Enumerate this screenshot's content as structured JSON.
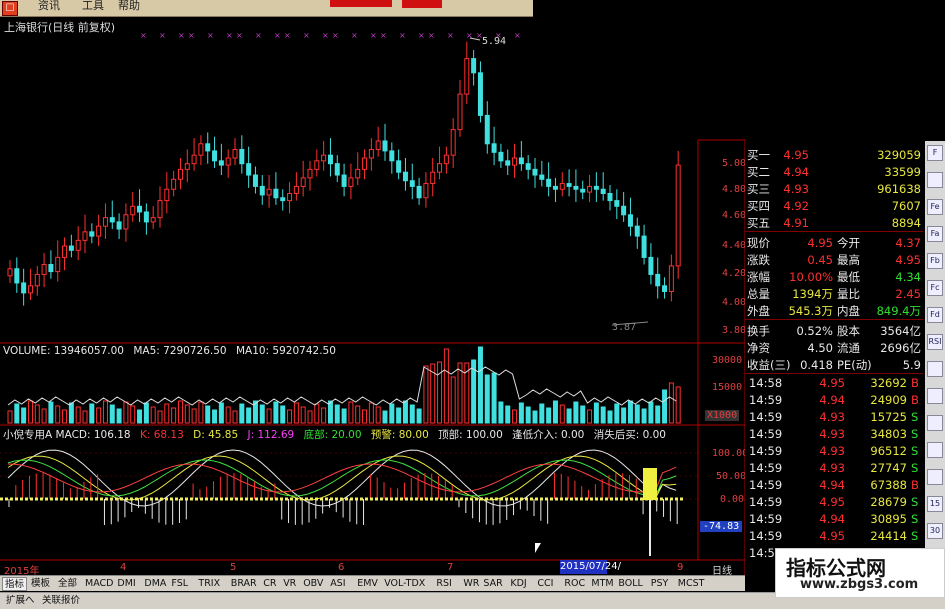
{
  "menu": {
    "logo": "☐",
    "items": [
      "资讯",
      "工具",
      "帮助"
    ]
  },
  "stock_title": "上海银行(日线 前复权)",
  "price_axis": [
    "5.00",
    "4.80",
    "4.60",
    "4.40",
    "4.20",
    "4.00",
    "3.80"
  ],
  "high_label": "5.94",
  "low_label": "3.87",
  "volume_line": {
    "label": "VOLUME: 13946057.00",
    "ma5": "MA5: 7290726.50",
    "ma10": "MA10: 5920742.50"
  },
  "volume_axis": [
    "30000",
    "15000",
    "X1000"
  ],
  "macd_line": {
    "name": "小倪专用A MACD: 106.18",
    "k": "K: 68.13",
    "d": "D: 45.85",
    "j": "J: 112.69",
    "bottom": "底部: 20.00",
    "warn": "预警: 80.00",
    "top": "顶部: 100.00",
    "buy": "逢低介入: 0.00",
    "sell": "消失后买: 0.00"
  },
  "macd_axis": [
    "100.00",
    "50.00",
    "0.00",
    "-74.83"
  ],
  "x_axis": {
    "year": "2015年",
    "months": [
      "4",
      "5",
      "6",
      "7",
      "9"
    ],
    "cursor_date": "2015/07/24/五",
    "period": "日线"
  },
  "quote": {
    "bids": [
      {
        "label": "买一",
        "price": "4.95",
        "vol": "329059"
      },
      {
        "label": "买二",
        "price": "4.94",
        "vol": "33599"
      },
      {
        "label": "买三",
        "price": "4.93",
        "vol": "961638"
      },
      {
        "label": "买四",
        "price": "4.92",
        "vol": "7607"
      },
      {
        "label": "买五",
        "price": "4.91",
        "vol": "8894"
      }
    ],
    "stats": [
      {
        "l1": "现价",
        "v1": "4.95",
        "l2": "今开",
        "v2": "4.37"
      },
      {
        "l1": "涨跌",
        "v1": "0.45",
        "l2": "最高",
        "v2": "4.95"
      },
      {
        "l1": "涨幅",
        "v1": "10.00%",
        "l2": "最低",
        "v2": "4.34"
      },
      {
        "l1": "总量",
        "v1": "1394万",
        "l2": "量比",
        "v2": "2.45"
      },
      {
        "l1": "外盘",
        "v1": "545.3万",
        "l2": "内盘",
        "v2": "849.4万"
      }
    ],
    "fund": [
      {
        "l1": "换手",
        "v1": "0.52%",
        "l2": "股本",
        "v2": "3564亿"
      },
      {
        "l1": "净资",
        "v1": "4.50",
        "l2": "流通",
        "v2": "2696亿"
      },
      {
        "l1": "收益(三)",
        "v1": "0.418",
        "l2": "PE(动)",
        "v2": "5.9"
      }
    ],
    "ticks": [
      {
        "t": "14:58",
        "p": "4.95",
        "v": "32692",
        "s": "B"
      },
      {
        "t": "14:59",
        "p": "4.94",
        "v": "24909",
        "s": "B"
      },
      {
        "t": "14:59",
        "p": "4.93",
        "v": "15725",
        "s": "S"
      },
      {
        "t": "14:59",
        "p": "4.93",
        "v": "34803",
        "s": "S"
      },
      {
        "t": "14:59",
        "p": "4.93",
        "v": "96512",
        "s": "S"
      },
      {
        "t": "14:59",
        "p": "4.93",
        "v": "27747",
        "s": "S"
      },
      {
        "t": "14:59",
        "p": "4.94",
        "v": "67388",
        "s": "B"
      },
      {
        "t": "14:59",
        "p": "4.95",
        "v": "28679",
        "s": "S"
      },
      {
        "t": "14:59",
        "p": "4.94",
        "v": "30895",
        "s": "S"
      },
      {
        "t": "14:59",
        "p": "4.95",
        "v": "24414",
        "s": "S"
      },
      {
        "t": "14:59",
        "p": "4.95",
        "v": "13183",
        "s": "S"
      }
    ]
  },
  "toolbar": [
    "指标",
    "模板",
    "全部",
    "MACD",
    "DMI",
    "DMA",
    "FSL",
    "TRIX",
    "BRAR",
    "CR",
    "VR",
    "OBV",
    "ASI",
    "EMV",
    "VOL-TDX",
    "RSI",
    "WR",
    "SAR",
    "KDJ",
    "CCI",
    "ROC",
    "MTM",
    "BOLL",
    "PSY",
    "MCST"
  ],
  "bottom": [
    "扩展へ",
    "关联报价"
  ],
  "side_icons": [
    "F",
    "",
    "Fe",
    "Fa",
    "Fb",
    "Fc",
    "Fd",
    "RSI",
    "",
    "",
    "",
    "",
    "",
    "15",
    "30"
  ],
  "watermark": {
    "title": "指标公式网",
    "url": "www.zbgs3.com"
  },
  "colors": {
    "up": "#ff3030",
    "down": "#40e0e0",
    "bg": "#000000",
    "panel": "#d4d0c8"
  }
}
